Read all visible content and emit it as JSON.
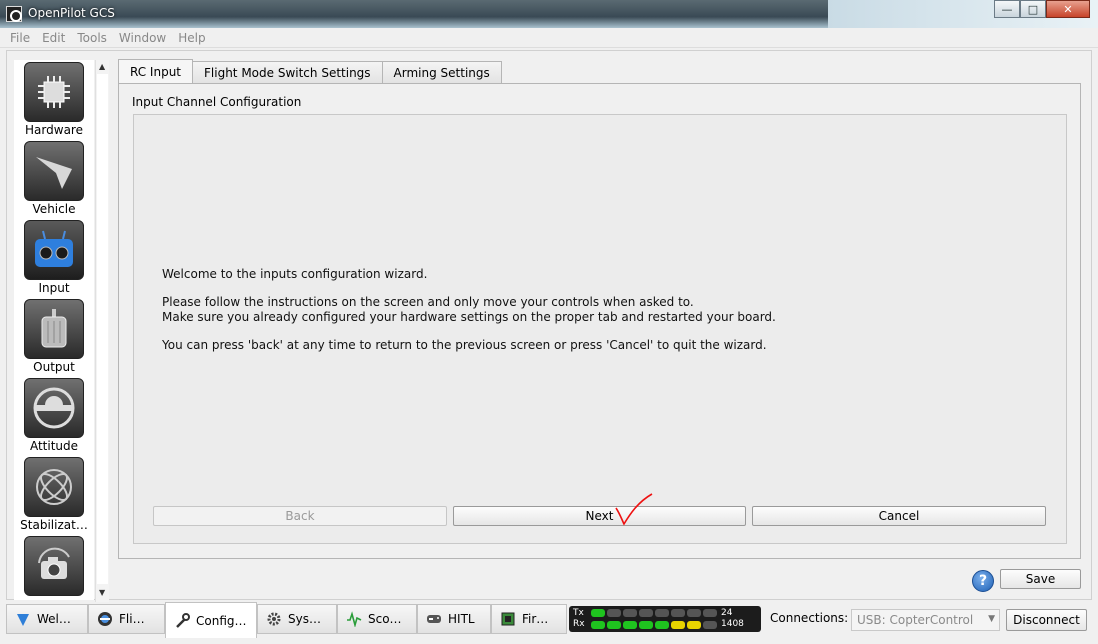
{
  "window": {
    "title": "OpenPilot GCS",
    "buttons": {
      "minimize": "—",
      "maximize": "□",
      "close": "✕"
    }
  },
  "menu": [
    "File",
    "Edit",
    "Tools",
    "Window",
    "Help"
  ],
  "sidebar": {
    "items": [
      {
        "label": "Hardware",
        "icon": "chip-icon"
      },
      {
        "label": "Vehicle",
        "icon": "jet-icon"
      },
      {
        "label": "Input",
        "icon": "remote-control-icon"
      },
      {
        "label": "Output",
        "icon": "motor-icon"
      },
      {
        "label": "Attitude",
        "icon": "level-icon"
      },
      {
        "label": "Stabilizat…",
        "icon": "gyro-icon"
      },
      {
        "label": "",
        "icon": "camera-icon"
      }
    ]
  },
  "tabs": [
    "RC Input",
    "Flight Mode Switch Settings",
    "Arming Settings"
  ],
  "group_title": "Input Channel Configuration",
  "wizard": {
    "welcome": "Welcome to the inputs configuration wizard.",
    "line1": "Please follow the instructions on the screen and only move your controls when asked to.",
    "line2": "Make sure you already configured your hardware settings on the proper tab and restarted your board.",
    "line3": "You can press 'back' at any time to return to the previous screen or press 'Cancel' to quit the wizard.",
    "back": "Back",
    "next": "Next",
    "cancel": "Cancel"
  },
  "help_icon": "?",
  "save": "Save",
  "bottom_tabs": [
    {
      "label": "Wel…",
      "icon": "welcome-icon"
    },
    {
      "label": "Fli…",
      "icon": "flight-icon"
    },
    {
      "label": "Config…",
      "icon": "wrench-icon"
    },
    {
      "label": "Sys…",
      "icon": "gear-icon"
    },
    {
      "label": "Sco…",
      "icon": "scope-icon"
    },
    {
      "label": "HITL",
      "icon": "gamepad-icon"
    },
    {
      "label": "Fir…",
      "icon": "firmware-chip-icon"
    }
  ],
  "telemetry": {
    "tx_label": "Tx",
    "rx_label": "Rx",
    "tx_value": "24",
    "rx_value": "1408",
    "tx_level": 0.08,
    "rx_level": 0.9,
    "colors": {
      "green": "#1fc41f",
      "yellow": "#e8d400",
      "red": "#e01010",
      "off": "#555555"
    }
  },
  "connections": {
    "label": "Connections:",
    "selected": "USB: CopterControl",
    "disconnect": "Disconnect"
  }
}
